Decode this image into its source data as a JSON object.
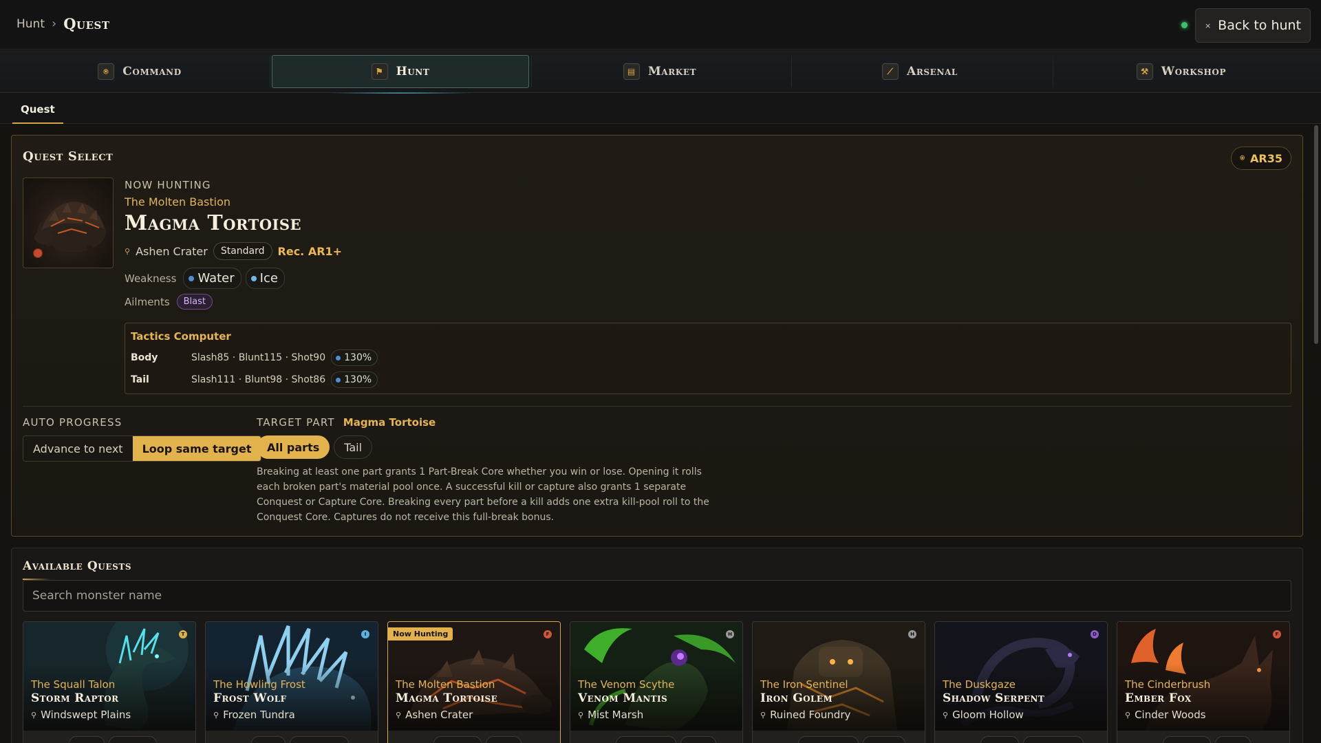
{
  "breadcrumb": {
    "parent": "Hunt",
    "separator": "›",
    "current": "Quest"
  },
  "header": {
    "back_label": "Back to hunt",
    "back_icon": "×",
    "status_color": "#3fbf6e"
  },
  "nav": {
    "tabs": [
      {
        "label": "Command",
        "icon": "⍟"
      },
      {
        "label": "Hunt",
        "icon": "⚑",
        "active": true
      },
      {
        "label": "Market",
        "icon": "▤"
      },
      {
        "label": "Arsenal",
        "icon": "⟋"
      },
      {
        "label": "Workshop",
        "icon": "⚒"
      }
    ]
  },
  "subtabs": {
    "active": "Quest"
  },
  "quest_select": {
    "title": "Quest Select",
    "rank_badge": "AR35",
    "now_hunting_label": "NOW HUNTING",
    "area_title": "The Molten Bastion",
    "monster": "Magma Tortoise",
    "location": "Ashen Crater",
    "difficulty": "Standard",
    "recommended": "Rec. AR1+",
    "weakness_label": "Weakness",
    "weaknesses": [
      "Water",
      "Ice"
    ],
    "ailments_label": "Ailments",
    "ailments": [
      "Blast"
    ],
    "tactics": {
      "title": "Tactics Computer",
      "rows": [
        {
          "part": "Body",
          "stats": "Slash85 · Blunt115 · Shot90",
          "pct": "130%"
        },
        {
          "part": "Tail",
          "stats": "Slash111 · Blunt98 · Shot86",
          "pct": "130%"
        }
      ]
    },
    "auto_progress_label": "AUTO PROGRESS",
    "auto_options": [
      "Advance to next",
      "Loop same target"
    ],
    "auto_selected": "Loop same target",
    "target_part_label": "TARGET PART",
    "target_part_monster": "Magma Tortoise",
    "parts": [
      "All parts",
      "Tail"
    ],
    "part_selected": "All parts",
    "description": "Breaking at least one part grants 1 Part-Break Core whether you win or lose. Opening it rolls each broken part's material pool once. A successful kill or capture also grants 1 separate Conquest or Capture Core. Breaking every part before a kill adds one extra kill-pool roll to the Conquest Core. Captures do not receive this full-break bonus."
  },
  "available_quests": {
    "title": "Available Quests",
    "search_placeholder": "Search monster name",
    "hunting_tag": "Now Hunting",
    "cards": [
      {
        "area": "The Squall Talon",
        "name": "Storm Raptor",
        "location": "Windswept Plains",
        "rank": "T",
        "rank_color": "#d9b14a",
        "hunting": false
      },
      {
        "area": "The Howling Frost",
        "name": "Frost Wolf",
        "location": "Frozen Tundra",
        "rank": "I",
        "rank_color": "#5fb0e0",
        "hunting": false
      },
      {
        "area": "The Molten Bastion",
        "name": "Magma Tortoise",
        "location": "Ashen Crater",
        "rank": "F",
        "rank_color": "#d2553a",
        "hunting": true
      },
      {
        "area": "The Venom Scythe",
        "name": "Venom Mantis",
        "location": "Mist Marsh",
        "rank": "H",
        "rank_color": "#9a9a9a",
        "hunting": false
      },
      {
        "area": "The Iron Sentinel",
        "name": "Iron Golem",
        "location": "Ruined Foundry",
        "rank": "H",
        "rank_color": "#9a9a9a",
        "hunting": false
      },
      {
        "area": "The Duskgaze",
        "name": "Shadow Serpent",
        "location": "Gloom Hollow",
        "rank": "D",
        "rank_color": "#8d5cc9",
        "hunting": false
      },
      {
        "area": "The Cinderbrush",
        "name": "Ember Fox",
        "location": "Cinder Woods",
        "rank": "F",
        "rank_color": "#d2553a",
        "hunting": false
      }
    ]
  }
}
